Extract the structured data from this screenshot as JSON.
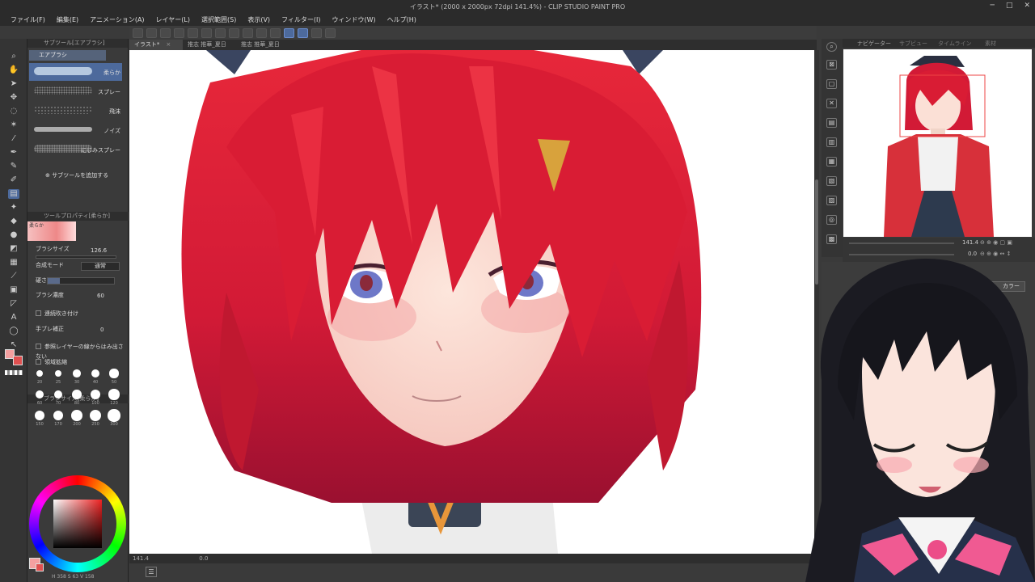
{
  "window": {
    "title": "イラスト* (2000 x 2000px 72dpi 141.4%)  - CLIP STUDIO PAINT PRO",
    "controls": [
      "─",
      "□",
      "✕"
    ]
  },
  "menu": [
    "ファイル(F)",
    "編集(E)",
    "アニメーション(A)",
    "レイヤー(L)",
    "選択範囲(S)",
    "表示(V)",
    "フィルター(I)",
    "ウィンドウ(W)",
    "ヘルプ(H)"
  ],
  "canvas_tabs": [
    {
      "label": "イラスト*",
      "active": true
    },
    {
      "label": "推志 推華_夏日",
      "active": false
    },
    {
      "label": "推志 推華_夏日",
      "active": false
    }
  ],
  "subtool": {
    "panel_title": "サブツール[エアブラシ]",
    "group_tab": "エアブラシ",
    "brushes": [
      {
        "label": "柔らか",
        "selected": true,
        "color": "#cfe0f0"
      },
      {
        "label": "スプレー",
        "selected": false,
        "color": "#9a9a9a"
      },
      {
        "label": "飛沫",
        "selected": false,
        "color": "#8a8a8a"
      },
      {
        "label": "ノイズ",
        "selected": false,
        "color": "#c8c8c8"
      },
      {
        "label": "にじみスプレー",
        "selected": false,
        "color": "#a0a0a0"
      }
    ],
    "add_label": "サブツールを追加する"
  },
  "tool_property": {
    "title": "ツールプロパティ[柔らか]",
    "preview_label": "柔らか",
    "brush_size_label": "ブラシサイズ",
    "brush_size_value": "126.6",
    "blend_label": "合成モード",
    "blend_value": "通常",
    "hardness_label": "硬さ",
    "density_label": "ブラシ濃度",
    "density_value": "60",
    "continuous_label": "連続吹き付け",
    "stabilizer_label": "手ブレ補正",
    "stabilizer_value": "0",
    "ref_layer_label": "参照レイヤーの線からはみ出さない",
    "area_label": "領域拡縮"
  },
  "brush_size_panel": {
    "title": "ブラシサイズ[柔らか]",
    "sizes": [
      "20",
      "25",
      "30",
      "40",
      "50",
      "60",
      "70",
      "80",
      "100",
      "120",
      "150",
      "170",
      "200",
      "250",
      "300"
    ]
  },
  "color": {
    "main": "#f4a0a0",
    "sub": "#e05050",
    "readout": "H 358 S 63 V 158"
  },
  "status": {
    "zoom": "141.4",
    "angle": "0.0"
  },
  "navigator": {
    "tabs": [
      "ナビゲーター",
      "サブビュー",
      "タイムライン",
      "素材"
    ],
    "zoom_value": "141.4",
    "angle_value": "0.0"
  },
  "layer_button": "カラー"
}
